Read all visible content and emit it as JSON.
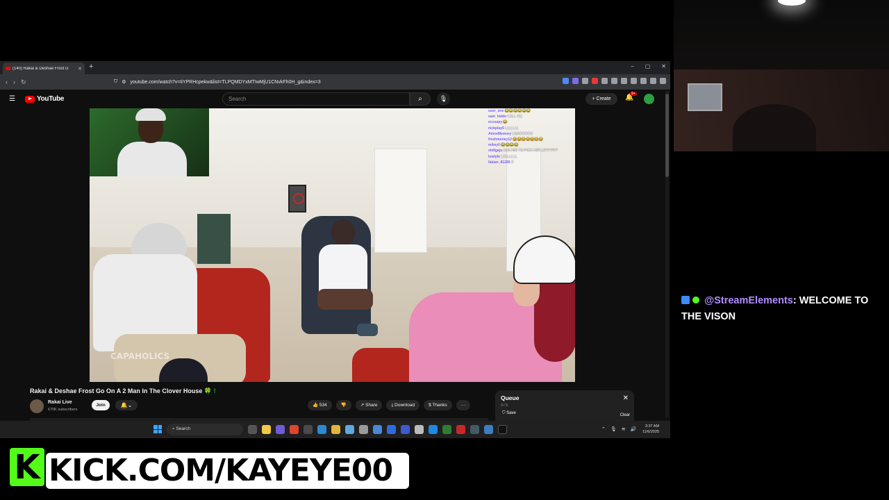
{
  "browser": {
    "tab_title": "(140) Rakai & Deshae Frost G",
    "new_tab": "+",
    "window_controls": [
      "–",
      "▢",
      "✕"
    ],
    "url": "youtube.com/watch?v=tiYPRHcpekw&list=TLPQMDYxMTIwMjU1CNvkFh0H_g&index=3"
  },
  "youtube": {
    "logo_text": "YouTube",
    "search_placeholder": "Search",
    "create_label": "+ Create",
    "notification_count": "9+",
    "video_title": "Rakai & Deshae Frost Go On A 2 Man In The Clover House",
    "title_suffix": "🍀 !",
    "channel_name": "Rakai Live",
    "subscribers": "670K subscribers",
    "join_label": "Join",
    "like_count": "534",
    "share_label": "Share",
    "download_label": "Download",
    "thanks_label": "Thanks",
    "more_label": "···"
  },
  "video_overlay": {
    "watermark": "CAPAHOLICS",
    "chat": [
      {
        "name": "user_one",
        "msg": "😂😂😂😂😂😂"
      },
      {
        "name": "sam_kiddo",
        "msg": "CALL 911"
      },
      {
        "name": "ecsoapy",
        "msg": "😂"
      },
      {
        "name": "nickplay5",
        "msg": "LLLLLLL"
      },
      {
        "name": "AloneMemory",
        "msg": "LMAOOOOO"
      },
      {
        "name": "freshmoney12",
        "msg": "😂😂😂😂😂😂😂"
      },
      {
        "name": "mikey0",
        "msg": "😂😂😂😂"
      },
      {
        "name": "shillgaju",
        "msg": "ASK HIM TO PICK HER UPPPPPP"
      },
      {
        "name": "lowlyfe",
        "msg": "LOLLLLLL"
      },
      {
        "name": "fabian_81289",
        "msg": "D"
      }
    ]
  },
  "queue": {
    "title": "Queue",
    "count": "3 / 3",
    "save_label": "Save",
    "clear_label": "Clear"
  },
  "taskbar": {
    "search": "Search",
    "time": "3:37 AM",
    "date": "11/6/2025"
  },
  "side_chat": {
    "username": "@StreamElements",
    "message": ": WELCOME TO THE VISON"
  },
  "banner": {
    "logo_letter": "K",
    "text": "KICK.COM/KAYEYE00"
  }
}
